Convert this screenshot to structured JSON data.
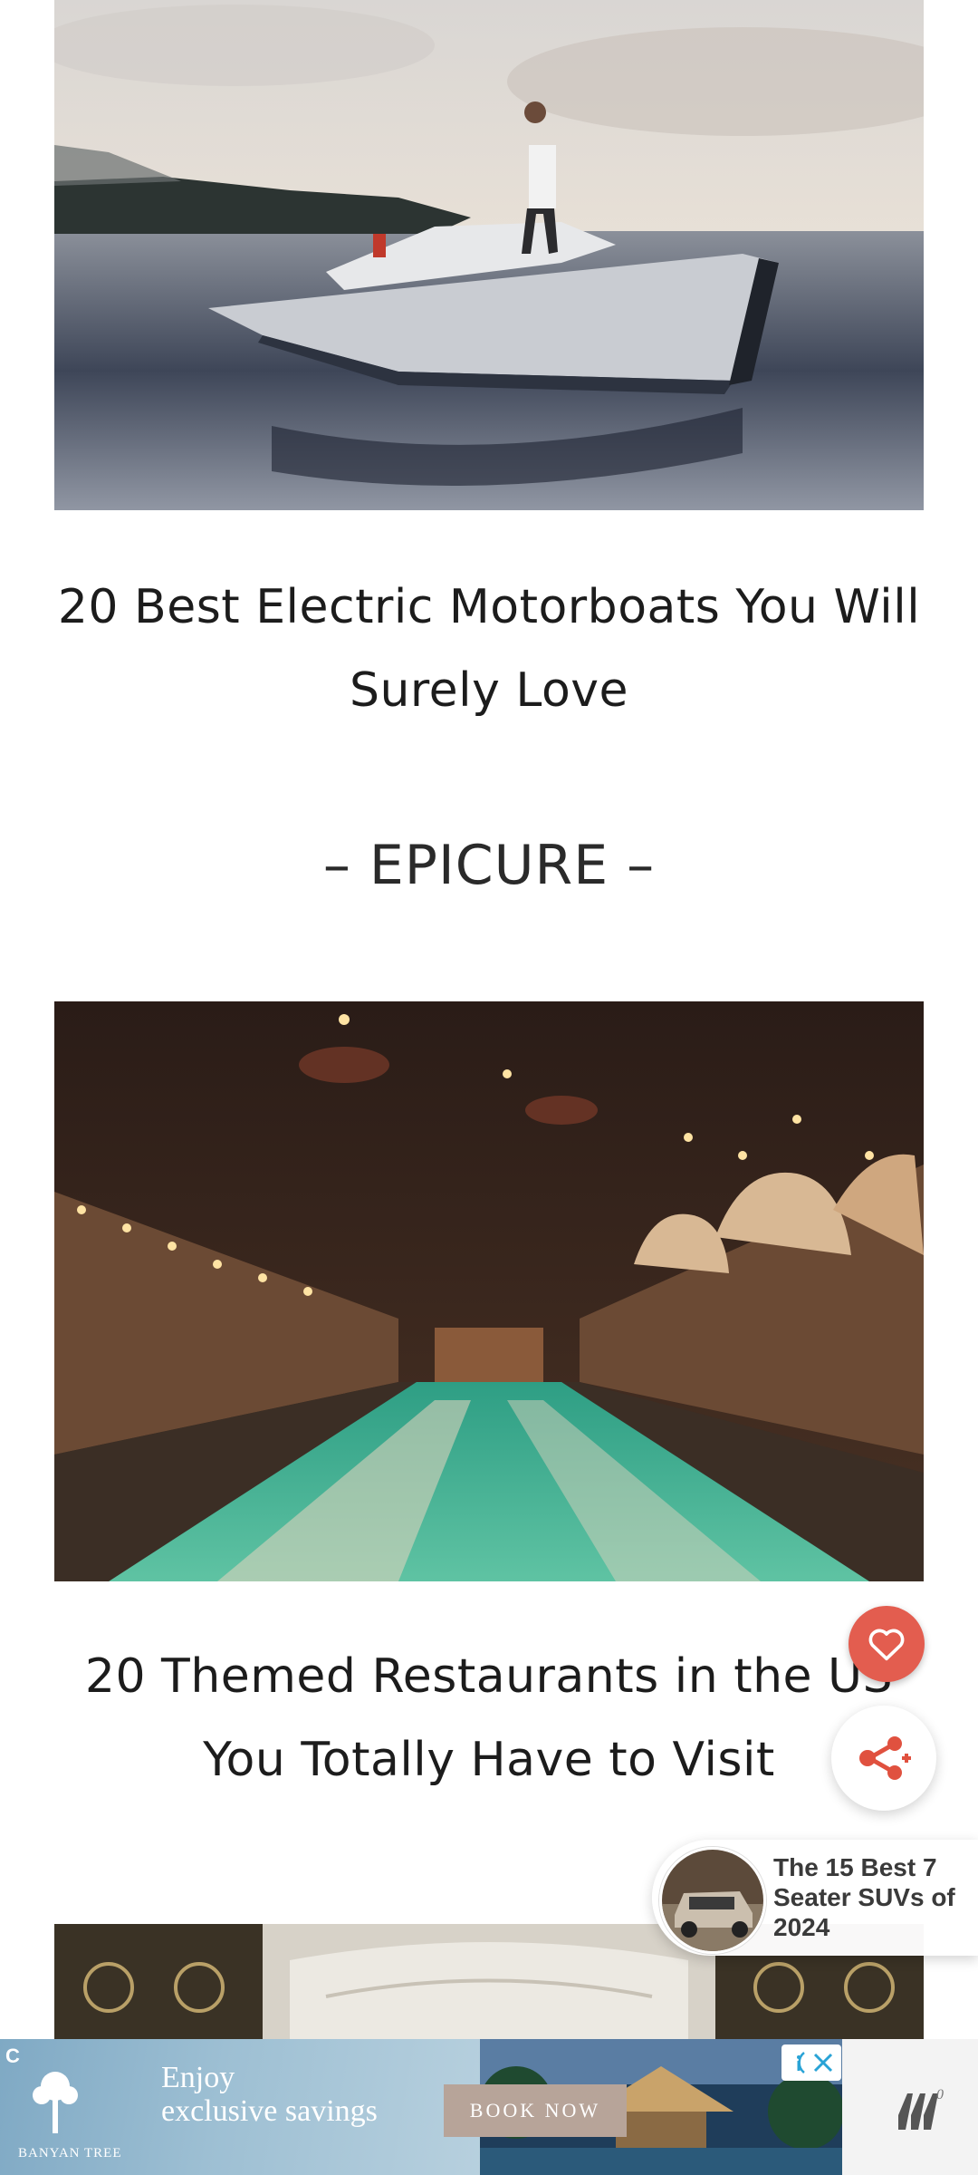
{
  "articles": [
    {
      "title": "20 Best Electric Motorboats You Will Surely Love"
    },
    {
      "title": "20 Themed Restaurants in the US You Totally Have to Visit"
    }
  ],
  "section": {
    "label": "– EPICURE –"
  },
  "actions": {
    "like_icon": "heart-icon",
    "share_icon": "share-icon"
  },
  "recommendation": {
    "text": "The 15 Best 7 Seater SUVs of 2024"
  },
  "ad": {
    "brand": "BANYAN TREE",
    "headline_line1": "Enjoy",
    "headline_line2": "exclusive savings",
    "cta": "BOOK NOW"
  },
  "colors": {
    "accent": "#e35d4f",
    "share": "#e0513f"
  }
}
